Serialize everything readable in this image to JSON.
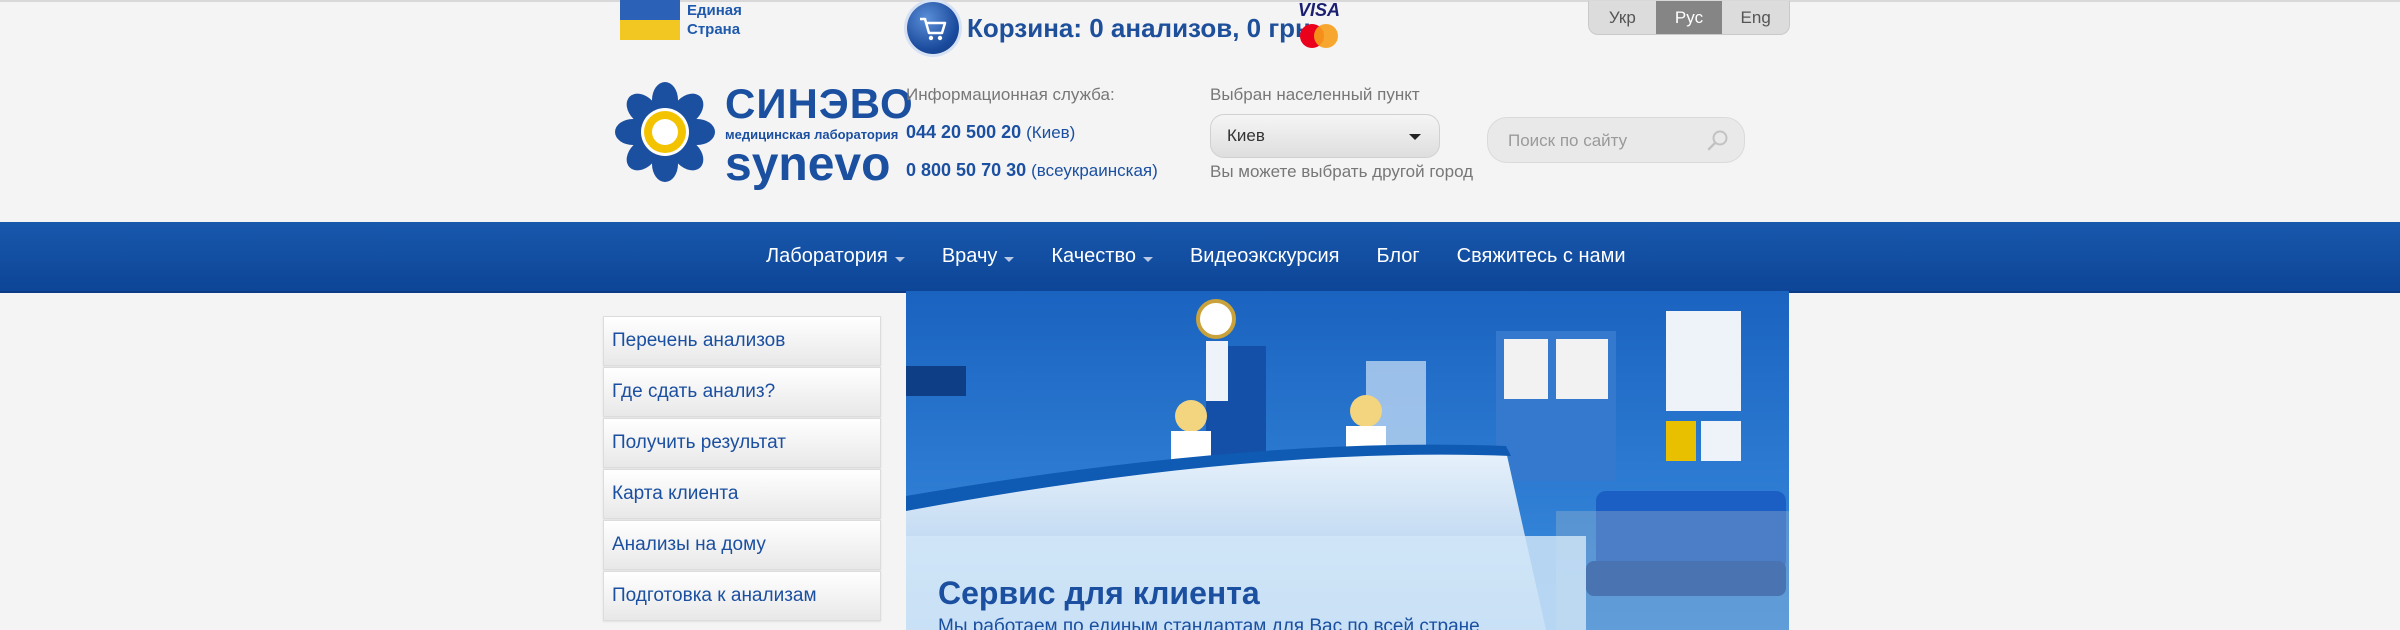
{
  "top": {
    "flag_text_line1": "Единая",
    "flag_text_line2": "Страна",
    "cart_text": "Корзина: 0 анализов, 0 грн.",
    "visa_text": "VISA",
    "languages": [
      "Укр",
      "Рус",
      "Eng"
    ],
    "active_language": "Рус"
  },
  "logo": {
    "name_ru": "СИНЭВО",
    "subtitle": "медицинская лаборатория",
    "name_en": "synevo"
  },
  "contacts": {
    "label": "Информационная служба:",
    "phone1": "044 20 500 20",
    "phone1_note": "(Киев)",
    "phone2": "0 800 50 70 30",
    "phone2_note": "(всеукраинская)"
  },
  "city": {
    "label": "Выбран населенный пункт",
    "value": "Киев",
    "hint": "Вы можете выбрать другой город"
  },
  "search": {
    "placeholder": "Поиск по сайту"
  },
  "nav": {
    "items": [
      {
        "label": "Лаборатория",
        "dropdown": true
      },
      {
        "label": "Врачу",
        "dropdown": true
      },
      {
        "label": "Качество",
        "dropdown": true
      },
      {
        "label": "Видеоэкскурсия",
        "dropdown": false
      },
      {
        "label": "Блог",
        "dropdown": false
      },
      {
        "label": "Свяжитесь с нами",
        "dropdown": false
      }
    ]
  },
  "sidebar": {
    "items": [
      "Перечень анализов",
      "Где сдать анализ?",
      "Получить результат",
      "Карта клиента",
      "Анализы на дому",
      "Подготовка к анализам"
    ]
  },
  "banner": {
    "title": "Сервис для клиента",
    "text": "Мы работаем по единым стандартам для Вас по всей стране"
  },
  "colors": {
    "brand_blue": "#1b4fa0",
    "nav_blue": "#1858ad",
    "page_bg": "#f4f4f5"
  }
}
